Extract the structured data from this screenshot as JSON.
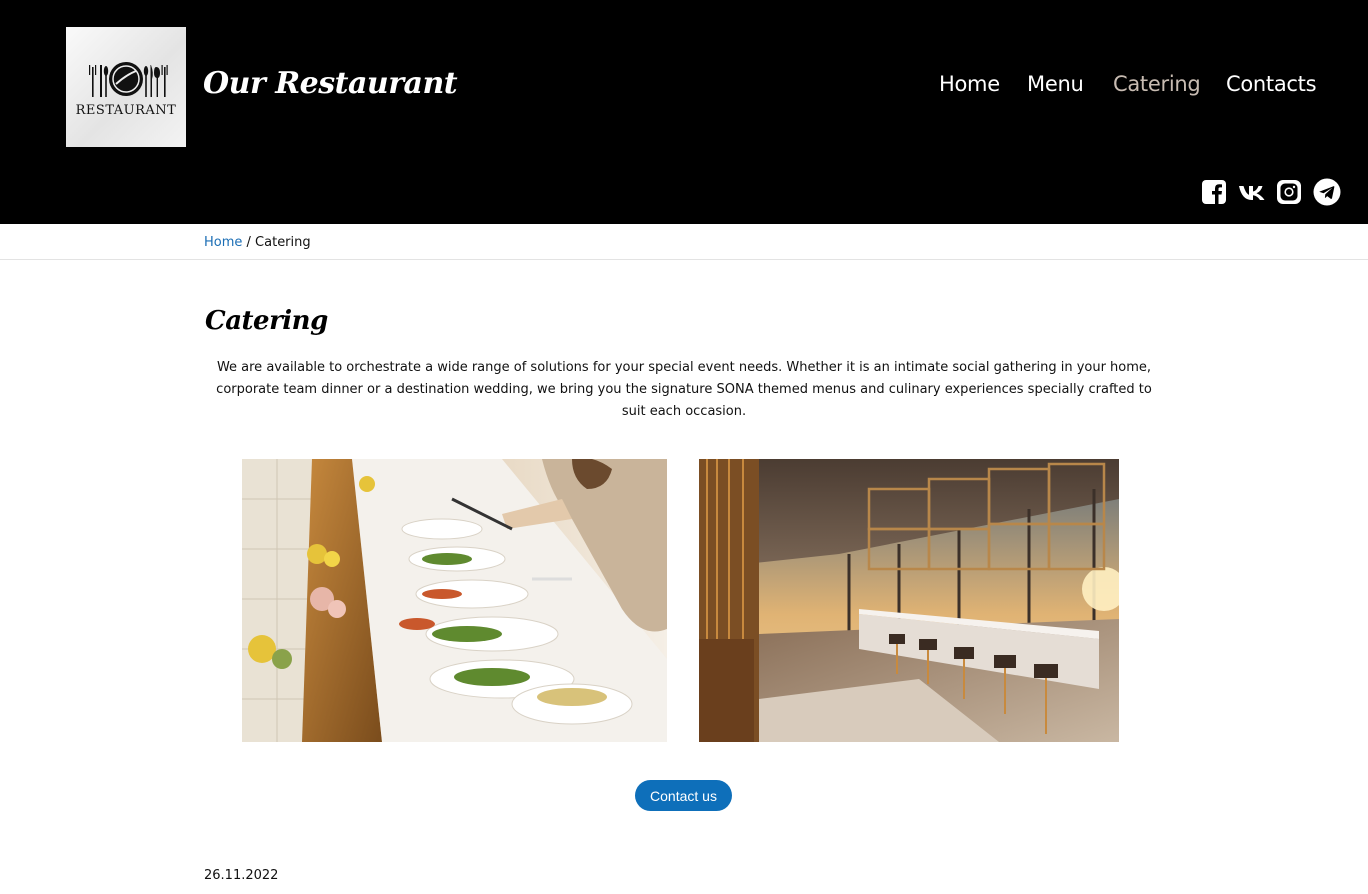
{
  "header": {
    "logo_text": "RESTAURANT",
    "site_title": "Our Restaurant",
    "nav": [
      {
        "label": "Home",
        "active": false
      },
      {
        "label": "Menu",
        "active": false
      },
      {
        "label": "Catering",
        "active": true
      },
      {
        "label": "Contacts",
        "active": false
      }
    ],
    "socials": [
      {
        "icon": "facebook-icon"
      },
      {
        "icon": "vk-icon"
      },
      {
        "icon": "instagram-icon"
      },
      {
        "icon": "telegram-icon"
      }
    ]
  },
  "breadcrumb": {
    "home": "Home",
    "separator": " / ",
    "current": "Catering"
  },
  "main": {
    "title": "Catering",
    "intro": "We are available to orchestrate a wide range of solutions for your special event needs. Whether it is an intimate social gathering in your home, corporate team dinner or a destination wedding, we bring you the signature SONA themed menus and culinary experiences specially crafted to suit each occasion.",
    "images": [
      {
        "subject": "catering buffet table photo"
      },
      {
        "subject": "restaurant bar interior photo"
      }
    ],
    "contact_button": "Contact us",
    "date": "26.11.2022"
  },
  "colors": {
    "header_bg": "#000000",
    "link": "#1b6eb5",
    "button": "#0e6fba",
    "nav_active": "#c8bcb2"
  }
}
